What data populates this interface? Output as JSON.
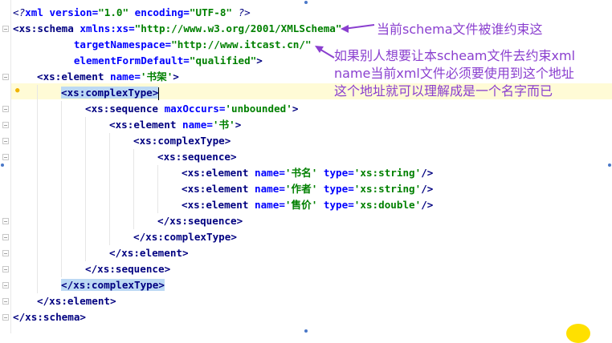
{
  "editor": {
    "lines": [
      {
        "parts": [
          {
            "t": "<?",
            "c": "pc"
          },
          {
            "t": "xml version=",
            "c": "an"
          },
          {
            "t": "\"1.0\"",
            "c": "av"
          },
          {
            "t": " encoding=",
            "c": "an"
          },
          {
            "t": "\"UTF-8\"",
            "c": "av"
          },
          {
            "t": " ?>",
            "c": "pc"
          }
        ]
      },
      {
        "parts": [
          {
            "t": "<xs:schema ",
            "c": "tg"
          },
          {
            "t": "xmlns:xs=",
            "c": "an"
          },
          {
            "t": "\"http://www.w3.org/2001/XMLSchema\"",
            "c": "av"
          }
        ]
      },
      {
        "pad": "          ",
        "parts": [
          {
            "t": "targetNamespace=",
            "c": "an"
          },
          {
            "t": "\"http://www.itcast.cn/\"",
            "c": "av"
          }
        ]
      },
      {
        "pad": "          ",
        "parts": [
          {
            "t": "elementFormDefault=",
            "c": "an"
          },
          {
            "t": "\"qualified\"",
            "c": "av"
          },
          {
            "t": ">",
            "c": "tg"
          }
        ]
      },
      {
        "indent": 1,
        "parts": [
          {
            "t": "<xs:element ",
            "c": "tg"
          },
          {
            "t": "name=",
            "c": "an"
          },
          {
            "t": "'书架'",
            "c": "av"
          },
          {
            "t": ">",
            "c": "tg"
          }
        ]
      },
      {
        "indent": 2,
        "parts": [
          {
            "t": "<xs:complexType>",
            "c": "tg sel"
          }
        ],
        "caret": true
      },
      {
        "indent": 3,
        "parts": [
          {
            "t": "<xs:sequence ",
            "c": "tg"
          },
          {
            "t": "maxOccurs=",
            "c": "an"
          },
          {
            "t": "'unbounded'",
            "c": "av"
          },
          {
            "t": ">",
            "c": "tg"
          }
        ]
      },
      {
        "indent": 4,
        "parts": [
          {
            "t": "<xs:element ",
            "c": "tg"
          },
          {
            "t": "name=",
            "c": "an"
          },
          {
            "t": "'书'",
            "c": "av"
          },
          {
            "t": ">",
            "c": "tg"
          }
        ]
      },
      {
        "indent": 5,
        "parts": [
          {
            "t": "<xs:complexType>",
            "c": "tg"
          }
        ]
      },
      {
        "indent": 6,
        "parts": [
          {
            "t": "<xs:sequence>",
            "c": "tg"
          }
        ]
      },
      {
        "indent": 7,
        "parts": [
          {
            "t": "<xs:element ",
            "c": "tg"
          },
          {
            "t": "name=",
            "c": "an"
          },
          {
            "t": "'书名'",
            "c": "av"
          },
          {
            "t": " type=",
            "c": "an"
          },
          {
            "t": "'xs:string'",
            "c": "av"
          },
          {
            "t": "/>",
            "c": "tg"
          }
        ]
      },
      {
        "indent": 7,
        "parts": [
          {
            "t": "<xs:element ",
            "c": "tg"
          },
          {
            "t": "name=",
            "c": "an"
          },
          {
            "t": "'作者'",
            "c": "av"
          },
          {
            "t": " type=",
            "c": "an"
          },
          {
            "t": "'xs:string'",
            "c": "av"
          },
          {
            "t": "/>",
            "c": "tg"
          }
        ]
      },
      {
        "indent": 7,
        "parts": [
          {
            "t": "<xs:element ",
            "c": "tg"
          },
          {
            "t": "name=",
            "c": "an"
          },
          {
            "t": "'售价'",
            "c": "av"
          },
          {
            "t": " type=",
            "c": "an"
          },
          {
            "t": "'xs:double'",
            "c": "av"
          },
          {
            "t": "/>",
            "c": "tg"
          }
        ]
      },
      {
        "indent": 6,
        "parts": [
          {
            "t": "</xs:sequence>",
            "c": "tg"
          }
        ]
      },
      {
        "indent": 5,
        "parts": [
          {
            "t": "</xs:complexType>",
            "c": "tg"
          }
        ]
      },
      {
        "indent": 4,
        "parts": [
          {
            "t": "</xs:element>",
            "c": "tg"
          }
        ]
      },
      {
        "indent": 3,
        "parts": [
          {
            "t": "</xs:sequence>",
            "c": "tg"
          }
        ]
      },
      {
        "indent": 2,
        "parts": [
          {
            "t": "</xs:complexType>",
            "c": "tg sel"
          }
        ]
      },
      {
        "indent": 1,
        "parts": [
          {
            "t": "</xs:element>",
            "c": "tg"
          }
        ]
      },
      {
        "parts": [
          {
            "t": "</xs:schema>",
            "c": "tg"
          }
        ]
      }
    ]
  },
  "annotations": {
    "note1": "当前schema文件被谁约束这",
    "note2_line1": "如果别人想要让本scheam文件去约束xml",
    "note2_line2": "name当前xml文件必须要使用到这个地址",
    "note2_line3": "这个地址就可以理解成是一个名字而已"
  },
  "colors": {
    "tag": "#000080",
    "attr_name": "#0000ff",
    "attr_value": "#008000",
    "annotation": "#8a3fcf",
    "selection": "#bcd9f4",
    "current_line": "#fffbd6"
  }
}
